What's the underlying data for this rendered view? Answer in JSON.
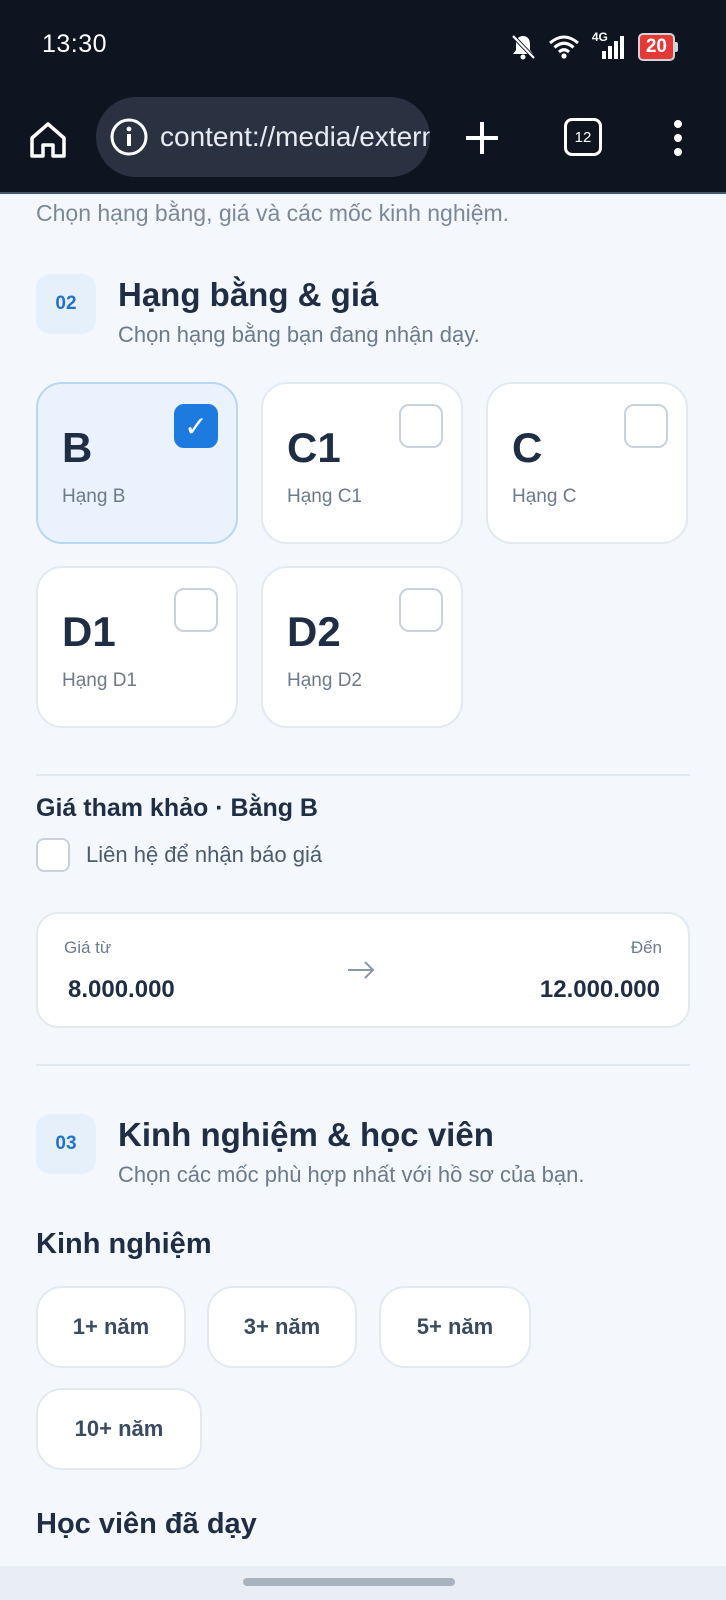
{
  "status_bar": {
    "time": "13:30",
    "network": "4G",
    "battery": "20",
    "icons": [
      "bell-off-icon",
      "wifi-icon",
      "signal-icon",
      "battery-icon"
    ]
  },
  "browser": {
    "url": "content://media/external",
    "tab_count": "12",
    "icons": [
      "home-icon",
      "info-icon",
      "plus-icon",
      "tabs-icon",
      "more-vert-icon"
    ]
  },
  "intro_text": "Chọn hạng bằng, giá và các mốc kinh nghiệm.",
  "section_license": {
    "step": "02",
    "title": "Hạng bằng & giá",
    "subtitle": "Chọn hạng bằng bạn đang nhận dạy.",
    "cards": [
      {
        "code": "B",
        "name": "Hạng B",
        "checked": true
      },
      {
        "code": "C1",
        "name": "Hạng C1",
        "checked": false
      },
      {
        "code": "C",
        "name": "Hạng C",
        "checked": false
      },
      {
        "code": "D1",
        "name": "Hạng D1",
        "checked": false
      },
      {
        "code": "D2",
        "name": "Hạng D2",
        "checked": false
      }
    ],
    "check_mark": "✓"
  },
  "price": {
    "title": "Giá tham khảo · Bằng B",
    "contact_label": "Liên hệ để nhận báo giá",
    "from_label": "Giá từ",
    "to_label": "Đến",
    "from_value": "8.000.000",
    "to_value": "12.000.000"
  },
  "section_experience": {
    "step": "03",
    "title": "Kinh nghiệm & học viên",
    "subtitle": "Chọn các mốc phù hợp nhất với hồ sơ của bạn.",
    "experience_heading": "Kinh nghiệm",
    "experience_options": [
      "1+ năm",
      "3+ năm",
      "5+ năm",
      "10+ năm"
    ],
    "students_heading": "Học viên đã dạy"
  },
  "colors": {
    "accent": "#1d7be0",
    "background": "#f4f8fd",
    "status_bar": "#0f1520",
    "battery_low": "#e53935"
  }
}
